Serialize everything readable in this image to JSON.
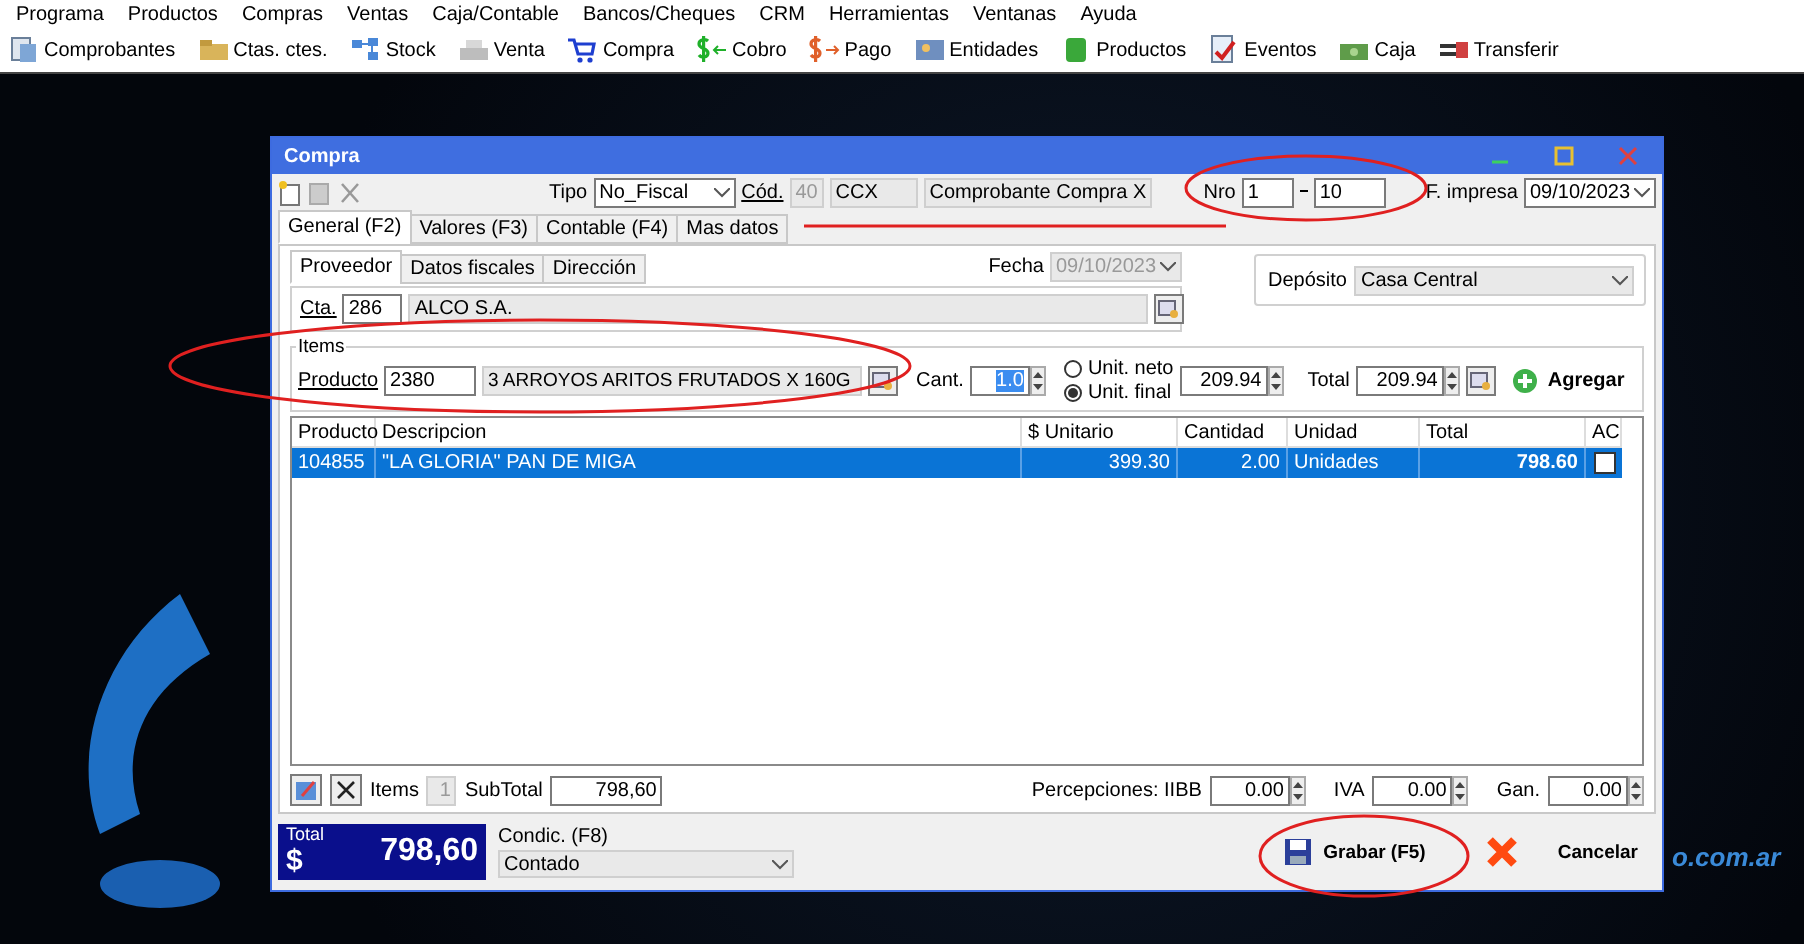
{
  "menu": [
    "Programa",
    "Productos",
    "Compras",
    "Ventas",
    "Caja/Contable",
    "Bancos/Cheques",
    "CRM",
    "Herramientas",
    "Ventanas",
    "Ayuda"
  ],
  "toolbar": [
    {
      "label": "Comprobantes",
      "kind": "docs"
    },
    {
      "label": "Ctas. ctes.",
      "kind": "folder"
    },
    {
      "label": "Stock",
      "kind": "boxes"
    },
    {
      "label": "Venta",
      "kind": "register"
    },
    {
      "label": "Compra",
      "kind": "cart"
    },
    {
      "label": "Cobro",
      "kind": "money-in"
    },
    {
      "label": "Pago",
      "kind": "money-out"
    },
    {
      "label": "Entidades",
      "kind": "card"
    },
    {
      "label": "Productos",
      "kind": "product"
    },
    {
      "label": "Eventos",
      "kind": "check"
    },
    {
      "label": "Caja",
      "kind": "cash"
    },
    {
      "label": "Transferir",
      "kind": "transfer"
    }
  ],
  "desktop": {
    "wallpaper_text": "o.com.ar"
  },
  "window": {
    "title": "Compra"
  },
  "header": {
    "tipo_label": "Tipo",
    "tipo_value": "No_Fiscal",
    "cod_label": "Cód.",
    "cod_number": "40",
    "cod_code": "CCX",
    "cod_description": "Comprobante Compra X",
    "nro_label": "Nro",
    "nro_from": "1",
    "nro_to": "10",
    "fecha_impresa_label": "F. impresa",
    "fecha_impresa_value": "09/10/2023"
  },
  "tabs": [
    {
      "label": "General (F2)",
      "selected": true
    },
    {
      "label": "Valores (F3)",
      "selected": false
    },
    {
      "label": "Contable (F4)",
      "selected": false
    },
    {
      "label": "Mas datos",
      "selected": false
    }
  ],
  "subtabs": [
    {
      "label": "Proveedor",
      "selected": true
    },
    {
      "label": "Datos fiscales",
      "selected": false
    },
    {
      "label": "Dirección",
      "selected": false
    }
  ],
  "fecha": {
    "label": "Fecha",
    "value": "09/10/2023",
    "disabled": true
  },
  "deposito": {
    "label": "Depósito",
    "value": "Casa Central"
  },
  "cuenta": {
    "label": "Cta.",
    "code": "286",
    "name": "ALCO S.A."
  },
  "items": {
    "group_label": "Items",
    "producto_label": "Producto",
    "producto_code": "2380",
    "producto_desc": "3 ARROYOS ARITOS FRUTADOS X 160G",
    "cant_label": "Cant.",
    "cant_value": "1.0",
    "radios": [
      {
        "label": "Unit. neto",
        "selected": false
      },
      {
        "label": "Unit. final",
        "selected": true
      }
    ],
    "unit_value": "209.94",
    "total_label": "Total",
    "total_value": "209.94",
    "add_label": "Agregar"
  },
  "table": {
    "columns": [
      "Producto",
      "Descripcion",
      "$ Unitario",
      "Cantidad",
      "Unidad",
      "Total",
      "AC"
    ],
    "rows": [
      {
        "cells": [
          "104855",
          "\"LA GLORIA\" PAN DE MIGA",
          "399.30",
          "2.00",
          "Unidades",
          "798.60"
        ],
        "selected": true,
        "ac_checked": false
      }
    ]
  },
  "summary": {
    "items_label": "Items",
    "items_count": "1",
    "subtotal_label": "SubTotal",
    "subtotal_value": "798,60",
    "perc_label": "Percepciones: IIBB",
    "iibb_value": "0.00",
    "iva_label": "IVA",
    "iva_value": "0.00",
    "gan_label": "Gan.",
    "gan_value": "0.00"
  },
  "footer": {
    "total_label": "Total",
    "currency": "$",
    "total_value": "798,60",
    "condic_label": "Condic. (F8)",
    "condic_value": "Contado",
    "save_label": "Grabar (F5)",
    "cancel_label": "Cancelar"
  }
}
